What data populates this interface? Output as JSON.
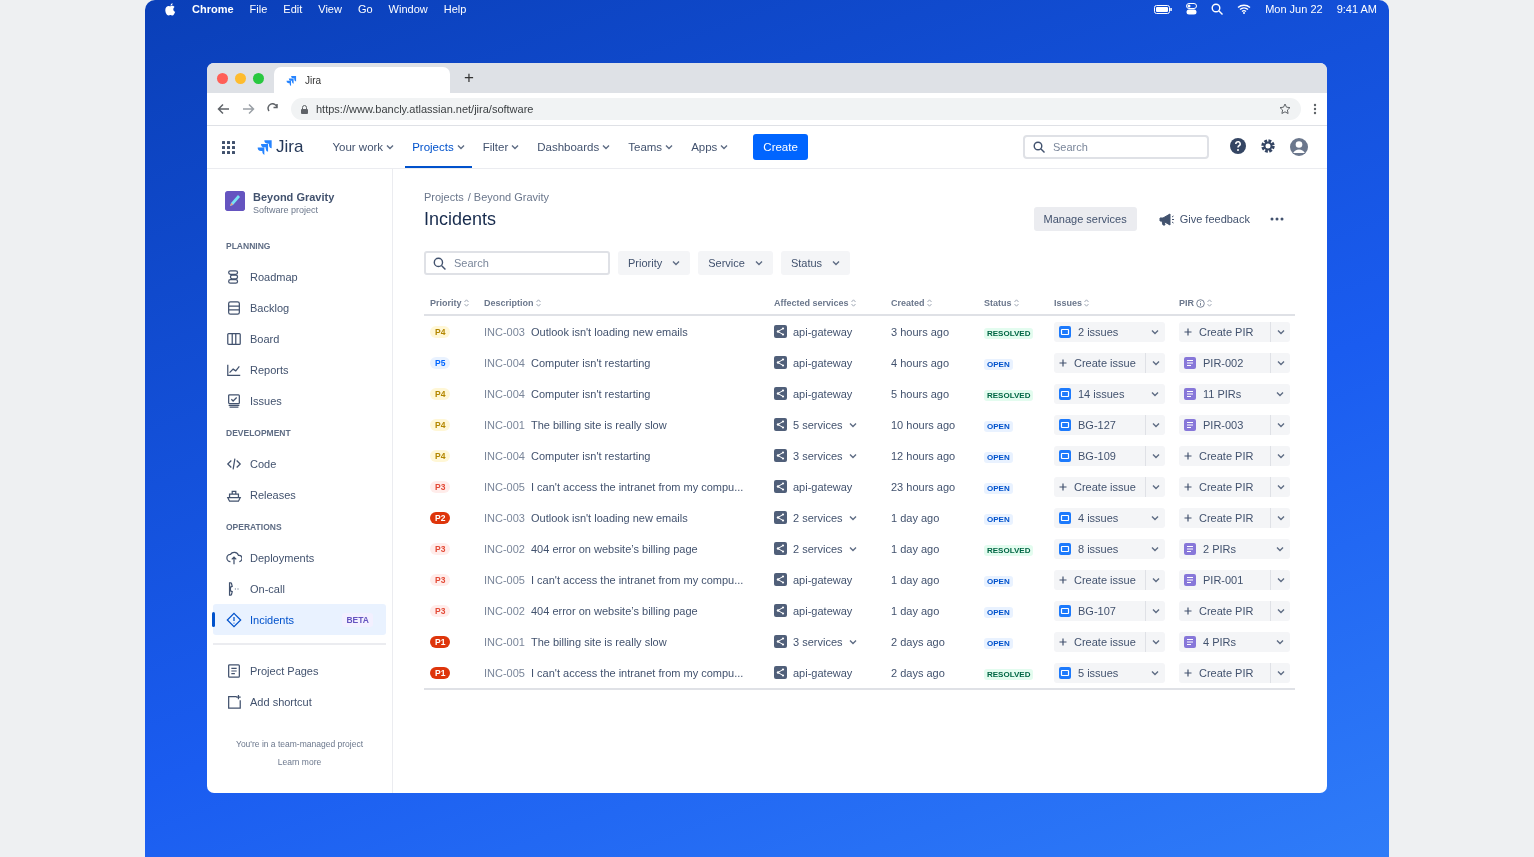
{
  "menu_bar": {
    "app": "Chrome",
    "menus": [
      "File",
      "Edit",
      "View",
      "Go",
      "Window",
      "Help"
    ],
    "date": "Mon Jun 22",
    "time": "9:41 AM"
  },
  "browser": {
    "tab_title": "Jira",
    "new_tab": "+",
    "url": "https://www.bancly.atlassian.net/jira/software"
  },
  "top_nav": {
    "product": "Jira",
    "items": [
      {
        "label": "Your work",
        "selected": false
      },
      {
        "label": "Projects",
        "selected": true
      },
      {
        "label": "Filter",
        "selected": false
      },
      {
        "label": "Dashboards",
        "selected": false
      },
      {
        "label": "Teams",
        "selected": false
      },
      {
        "label": "Apps",
        "selected": false
      }
    ],
    "create": "Create",
    "search_placeholder": "Search"
  },
  "sidebar": {
    "project_name": "Beyond Gravity",
    "project_type": "Software project",
    "sections": [
      {
        "title": "PLANNING",
        "items": [
          {
            "label": "Roadmap",
            "selected": false
          },
          {
            "label": "Backlog",
            "selected": false
          },
          {
            "label": "Board",
            "selected": false
          },
          {
            "label": "Reports",
            "selected": false
          },
          {
            "label": "Issues",
            "selected": false
          }
        ]
      },
      {
        "title": "DEVELOPMENT",
        "items": [
          {
            "label": "Code",
            "selected": false
          },
          {
            "label": "Releases",
            "selected": false
          }
        ]
      },
      {
        "title": "OPERATIONS",
        "items": [
          {
            "label": "Deployments",
            "selected": false
          },
          {
            "label": "On-call",
            "selected": false
          },
          {
            "label": "Incidents",
            "selected": true,
            "badge": "BETA"
          }
        ]
      }
    ],
    "extra_items": [
      {
        "label": "Project Pages",
        "selected": false
      },
      {
        "label": "Add shortcut",
        "selected": false
      }
    ],
    "footer_note": "You're in a team-managed project",
    "footer_link": "Learn more"
  },
  "breadcrumbs": [
    "Projects",
    "/ Beyond Gravity"
  ],
  "page_title": "Incidents",
  "actions": {
    "manage": "Manage services",
    "feedback": "Give feedback"
  },
  "filters": {
    "search_placeholder": "Search",
    "dropdowns": [
      "Priority",
      "Service",
      "Status"
    ]
  },
  "table": {
    "columns": [
      "Priority",
      "Description",
      "Affected services",
      "Created",
      "Status",
      "Issues",
      "PIR"
    ],
    "rows": [
      {
        "priority": {
          "label": "P4",
          "kind": "moderate"
        },
        "id": "INC-003",
        "description": "Outlook isn't loading new emails",
        "service": {
          "label": "api-gateway",
          "expandable": false
        },
        "created": "3 hours ago",
        "status": {
          "label": "RESOLVED",
          "kind": "resolved"
        },
        "issues": {
          "kind": "count",
          "label": "2 issues"
        },
        "pir": {
          "kind": "create",
          "label": "Create PIR"
        }
      },
      {
        "priority": {
          "label": "P5",
          "kind": "minor"
        },
        "id": "INC-004",
        "description": "Computer isn't restarting",
        "service": {
          "label": "api-gateway",
          "expandable": false
        },
        "created": "4 hours ago",
        "status": {
          "label": "OPEN",
          "kind": "open"
        },
        "issues": {
          "kind": "create",
          "label": "Create issue"
        },
        "pir": {
          "kind": "item",
          "label": "PIR-002"
        }
      },
      {
        "priority": {
          "label": "P4",
          "kind": "moderate"
        },
        "id": "INC-004",
        "description": "Computer isn't restarting",
        "service": {
          "label": "api-gateway",
          "expandable": false
        },
        "created": "5 hours ago",
        "status": {
          "label": "RESOLVED",
          "kind": "resolved"
        },
        "issues": {
          "kind": "count",
          "label": "14 issues"
        },
        "pir": {
          "kind": "count",
          "label": "11 PIRs"
        }
      },
      {
        "priority": {
          "label": "P4",
          "kind": "moderate"
        },
        "id": "INC-001",
        "description": "The billing site is really slow",
        "service": {
          "label": "5 services",
          "expandable": true
        },
        "created": "10 hours ago",
        "status": {
          "label": "OPEN",
          "kind": "open"
        },
        "issues": {
          "kind": "item",
          "label": "BG-127"
        },
        "pir": {
          "kind": "item",
          "label": "PIR-003"
        }
      },
      {
        "priority": {
          "label": "P4",
          "kind": "moderate"
        },
        "id": "INC-004",
        "description": "Computer isn't restarting",
        "service": {
          "label": "3 services",
          "expandable": true
        },
        "created": "12 hours ago",
        "status": {
          "label": "OPEN",
          "kind": "open"
        },
        "issues": {
          "kind": "item",
          "label": "BG-109"
        },
        "pir": {
          "kind": "create",
          "label": "Create PIR"
        }
      },
      {
        "priority": {
          "label": "P3",
          "kind": "major"
        },
        "id": "INC-005",
        "description": "I can't access the intranet from my compu...",
        "service": {
          "label": "api-gateway",
          "expandable": false
        },
        "created": "23 hours ago",
        "status": {
          "label": "OPEN",
          "kind": "open"
        },
        "issues": {
          "kind": "create",
          "label": "Create issue"
        },
        "pir": {
          "kind": "create",
          "label": "Create PIR"
        }
      },
      {
        "priority": {
          "label": "P2",
          "kind": "critical"
        },
        "id": "INC-003",
        "description": "Outlook isn't loading new emails",
        "service": {
          "label": "2 services",
          "expandable": true
        },
        "created": "1 day ago",
        "status": {
          "label": "OPEN",
          "kind": "open"
        },
        "issues": {
          "kind": "count",
          "label": "4 issues"
        },
        "pir": {
          "kind": "create",
          "label": "Create PIR"
        }
      },
      {
        "priority": {
          "label": "P3",
          "kind": "major"
        },
        "id": "INC-002",
        "description": "404 error on website’s billing page",
        "service": {
          "label": "2 services",
          "expandable": true
        },
        "created": "1 day ago",
        "status": {
          "label": "RESOLVED",
          "kind": "resolved"
        },
        "issues": {
          "kind": "count",
          "label": "8 issues"
        },
        "pir": {
          "kind": "count",
          "label": "2 PIRs"
        }
      },
      {
        "priority": {
          "label": "P3",
          "kind": "major"
        },
        "id": "INC-005",
        "description": "I can't access the intranet from my compu...",
        "service": {
          "label": "api-gateway",
          "expandable": false
        },
        "created": "1 day ago",
        "status": {
          "label": "OPEN",
          "kind": "open"
        },
        "issues": {
          "kind": "create",
          "label": "Create issue"
        },
        "pir": {
          "kind": "item",
          "label": "PIR-001"
        }
      },
      {
        "priority": {
          "label": "P3",
          "kind": "major"
        },
        "id": "INC-002",
        "description": "404 error on website’s billing page",
        "service": {
          "label": "api-gateway",
          "expandable": false
        },
        "created": "1 day ago",
        "status": {
          "label": "OPEN",
          "kind": "open"
        },
        "issues": {
          "kind": "item",
          "label": "BG-107"
        },
        "pir": {
          "kind": "create",
          "label": "Create PIR"
        }
      },
      {
        "priority": {
          "label": "P1",
          "kind": "critical"
        },
        "id": "INC-001",
        "description": "The billing site is really slow",
        "service": {
          "label": "3 services",
          "expandable": true
        },
        "created": "2 days ago",
        "status": {
          "label": "OPEN",
          "kind": "open"
        },
        "issues": {
          "kind": "create",
          "label": "Create issue"
        },
        "pir": {
          "kind": "count",
          "label": "4 PIRs"
        }
      },
      {
        "priority": {
          "label": "P1",
          "kind": "critical"
        },
        "id": "INC-005",
        "description": "I can't access the intranet from my compu...",
        "service": {
          "label": "api-gateway",
          "expandable": false
        },
        "created": "2 days ago",
        "status": {
          "label": "RESOLVED",
          "kind": "resolved"
        },
        "issues": {
          "kind": "count",
          "label": "5 issues"
        },
        "pir": {
          "kind": "create",
          "label": "Create PIR"
        }
      }
    ]
  }
}
